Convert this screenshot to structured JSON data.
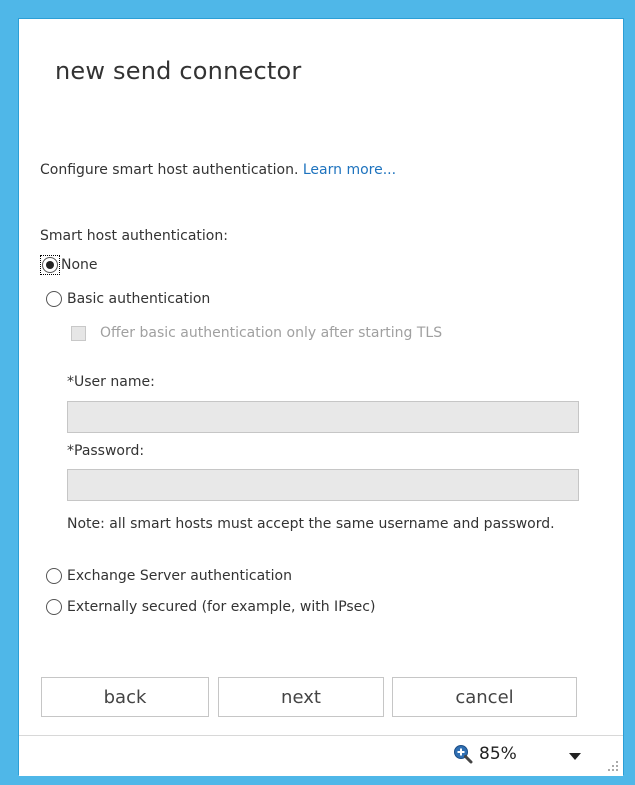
{
  "dialog": {
    "title": "new send connector",
    "intro_text": "Configure smart host authentication. ",
    "learn_more": "Learn more...",
    "section_label": "Smart host authentication:"
  },
  "options": {
    "none": {
      "label": "None",
      "selected": true
    },
    "basic": {
      "label": "Basic authentication",
      "selected": false
    },
    "exchange": {
      "label": "Exchange Server authentication",
      "selected": false
    },
    "external": {
      "label": "Externally secured (for example, with IPsec)",
      "selected": false
    }
  },
  "basic_settings": {
    "tls_checkbox_label": "Offer basic authentication only after starting TLS",
    "tls_checked": false,
    "username_label": "*User name:",
    "username_value": "",
    "password_label": "*Password:",
    "password_value": "",
    "note": "Note: all smart hosts must accept the same username and password."
  },
  "buttons": {
    "back": "back",
    "next": "next",
    "cancel": "cancel"
  },
  "statusbar": {
    "zoom": "85%"
  },
  "colors": {
    "frame": "#4fb7e8",
    "link": "#1e73be",
    "disabled_text": "#a0a0a0"
  }
}
